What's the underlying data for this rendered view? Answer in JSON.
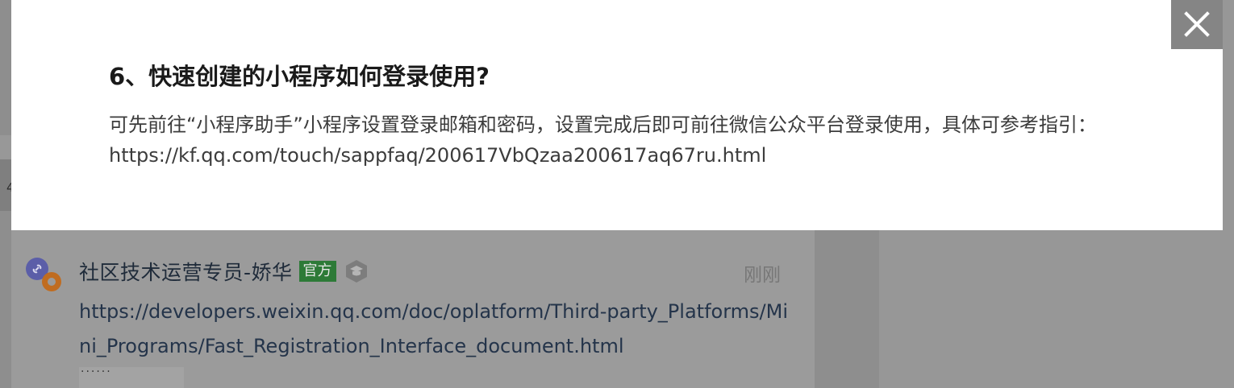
{
  "modal": {
    "faq_title": "6、快速创建的小程序如何登录使用?",
    "faq_body": "可先前往“小程序助手”小程序设置登录邮箱和密码，设置完成后即可前往微信公众平台登录使用，具体可参考指引：",
    "faq_url": "https://kf.qq.com/touch/sappfaq/200617VbQzaa200617aq67ru.html",
    "close_icon": "close-icon"
  },
  "comment": {
    "author": "社区技术运营专员-娇华",
    "official_badge": "官方",
    "level_icon": "level-badge-icon",
    "timestamp": "刚刚",
    "link_text": "https://developers.weixin.qq.com/doc/oplatform/Third-party_Platforms/Mini_Programs/Fast_Registration_Interface_document.html"
  },
  "colors": {
    "overlay": "#8e8e8e",
    "modal_bg": "#ffffff",
    "official_badge": "#2d7a37",
    "close_bg": "#858585"
  }
}
